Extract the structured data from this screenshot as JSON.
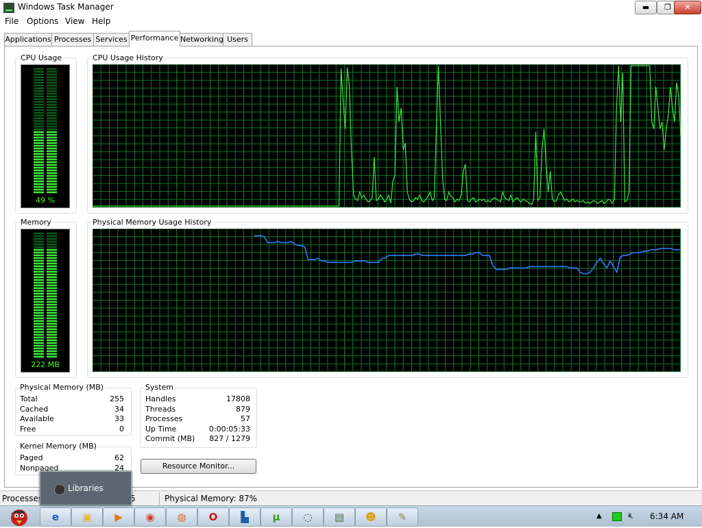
{
  "window": {
    "title": "Windows Task Manager",
    "controls": {
      "minimize": "▬",
      "maximize": "❐",
      "close": "✕"
    }
  },
  "menu": [
    "File",
    "Options",
    "View",
    "Help"
  ],
  "tabs": [
    "Applications",
    "Processes",
    "Services",
    "Performance",
    "Networking",
    "Users"
  ],
  "active_tab": "Performance",
  "cpu": {
    "label": "CPU Usage",
    "value_text": "49 %",
    "level": 0.49,
    "history_label": "CPU Usage History",
    "history": [
      0,
      0,
      0,
      0,
      0,
      0,
      0,
      0,
      0,
      0,
      0,
      0,
      0,
      0,
      0,
      0,
      0,
      0,
      0,
      0,
      0,
      0,
      0,
      0,
      0,
      0,
      0,
      0,
      0,
      0,
      0,
      0,
      0,
      0,
      0,
      0,
      0,
      0,
      0,
      0,
      0,
      0,
      0,
      0,
      0,
      0,
      0,
      0,
      0,
      0,
      0,
      0,
      0,
      0,
      0,
      0,
      0,
      0,
      0,
      0,
      0,
      0,
      0,
      0,
      0,
      0,
      0,
      0,
      0,
      0,
      0,
      0,
      0,
      0,
      0,
      0,
      0,
      0,
      0,
      0,
      0,
      0,
      0,
      0,
      0,
      0,
      0,
      0,
      0,
      0,
      0,
      0,
      0,
      0,
      0,
      0,
      0,
      0,
      0,
      0,
      0,
      0,
      0,
      0,
      0,
      0,
      0,
      0,
      0,
      0,
      0,
      0,
      0,
      0,
      0,
      0,
      0,
      0,
      0,
      0,
      98,
      75,
      55,
      99,
      85,
      40,
      8,
      5,
      4,
      10,
      6,
      8,
      5,
      3,
      4,
      6,
      35,
      4,
      5,
      8,
      6,
      3,
      5,
      8,
      2,
      18,
      22,
      85,
      60,
      70,
      40,
      45,
      10,
      5,
      3,
      4,
      6,
      5,
      8,
      4,
      3,
      5,
      7,
      10,
      4,
      6,
      55,
      100,
      60,
      20,
      5,
      4,
      10,
      7,
      6,
      3,
      5,
      4,
      8,
      25,
      30,
      4,
      3,
      5,
      6,
      3,
      4,
      5,
      4,
      5,
      3,
      4,
      3,
      5,
      6,
      5,
      4,
      3,
      10,
      6,
      5,
      4,
      8,
      3,
      5,
      6,
      4,
      3,
      5,
      4,
      3,
      2,
      1,
      5,
      53,
      4,
      6,
      40,
      55,
      30,
      10,
      25,
      5,
      3,
      4,
      8,
      10,
      7,
      4,
      5,
      3,
      4,
      5,
      3,
      4,
      3,
      3,
      4,
      2,
      3,
      2,
      3,
      4,
      3,
      2,
      3,
      4,
      2,
      3,
      5,
      4,
      2,
      5,
      70,
      100,
      60,
      95,
      3,
      4,
      10,
      100,
      100,
      100,
      100,
      100,
      100,
      100,
      100,
      100,
      100,
      60,
      55,
      85,
      70,
      55,
      60,
      40,
      55,
      65,
      85,
      70,
      60,
      88,
      78,
      50
    ],
    "history_grid": false
  },
  "memory": {
    "label": "Memory",
    "value_text": "222 MB",
    "level": 0.87,
    "history_label": "Physical Memory Usage History",
    "history": [
      96,
      96,
      96,
      95,
      91,
      91,
      91,
      92,
      91,
      91,
      91,
      92,
      90,
      89,
      89,
      88,
      79,
      79,
      79,
      80,
      78,
      78,
      77,
      77,
      77,
      77,
      77,
      77,
      77,
      77,
      78,
      78,
      78,
      78,
      77,
      77,
      77,
      77,
      80,
      80,
      82,
      82,
      82,
      82,
      82,
      82,
      82,
      82,
      83,
      83,
      82,
      82,
      82,
      82,
      82,
      82,
      82,
      82,
      82,
      82,
      82,
      82,
      82,
      82,
      83,
      83,
      84,
      84,
      82,
      82,
      82,
      75,
      72,
      72,
      72,
      72,
      73,
      73,
      73,
      73,
      73,
      73,
      74,
      74,
      74,
      74,
      74,
      74,
      74,
      74,
      74,
      74,
      74,
      74,
      73,
      73,
      73,
      70,
      69,
      69,
      70,
      73,
      77,
      80,
      76,
      73,
      78,
      74,
      70,
      81,
      82,
      82,
      83,
      84,
      84,
      84,
      85,
      85,
      86,
      86,
      86,
      87,
      87,
      87,
      87,
      86,
      86,
      86
    ]
  },
  "physical_memory": {
    "label": "Physical Memory (MB)",
    "rows": [
      {
        "name": "Total",
        "value": "255"
      },
      {
        "name": "Cached",
        "value": "34"
      },
      {
        "name": "Available",
        "value": "33"
      },
      {
        "name": "Free",
        "value": "0"
      }
    ]
  },
  "kernel_memory": {
    "label": "Kernel Memory (MB)",
    "rows": [
      {
        "name": "Paged",
        "value": "62"
      },
      {
        "name": "Nonpaged",
        "value": "24"
      }
    ]
  },
  "system": {
    "label": "System",
    "rows": [
      {
        "name": "Handles",
        "value": "17808"
      },
      {
        "name": "Threads",
        "value": "879"
      },
      {
        "name": "Processes",
        "value": "57"
      },
      {
        "name": "Up Time",
        "value": "0:00:05:33"
      },
      {
        "name": "Commit (MB)",
        "value": "827 / 1279"
      }
    ]
  },
  "resource_monitor_button": "Resource Monitor...",
  "statusbar": {
    "processes": "Processes:",
    "processes_tail": "5",
    "physical_memory": "Physical Memory: 87%"
  },
  "taskbar": {
    "popup_label": "Libraries",
    "clock": "6:34 AM",
    "buttons": [
      {
        "name": "internet-explorer-icon",
        "glyph": "e",
        "color": "#1a63c7"
      },
      {
        "name": "folder-icon",
        "glyph": "▣",
        "color": "#e8b830"
      },
      {
        "name": "media-player-icon",
        "glyph": "▶",
        "color": "#e07a10"
      },
      {
        "name": "chrome-icon",
        "glyph": "◉",
        "color": "#d83b2a"
      },
      {
        "name": "firefox-icon",
        "glyph": "◍",
        "color": "#e06a20"
      },
      {
        "name": "opera-icon",
        "glyph": "O",
        "color": "#c81818"
      },
      {
        "name": "app-icon",
        "glyph": "▙",
        "color": "#1e5fa8"
      },
      {
        "name": "utorrent-icon",
        "glyph": "µ",
        "color": "#3a9a2a"
      },
      {
        "name": "chat-icon",
        "glyph": "◌",
        "color": "#444"
      },
      {
        "name": "task-manager-icon",
        "glyph": "▤",
        "color": "#3c6e3c"
      },
      {
        "name": "messenger-icon",
        "glyph": "☻",
        "color": "#d6a010"
      },
      {
        "name": "tools-icon",
        "glyph": "✎",
        "color": "#884"
      }
    ]
  }
}
